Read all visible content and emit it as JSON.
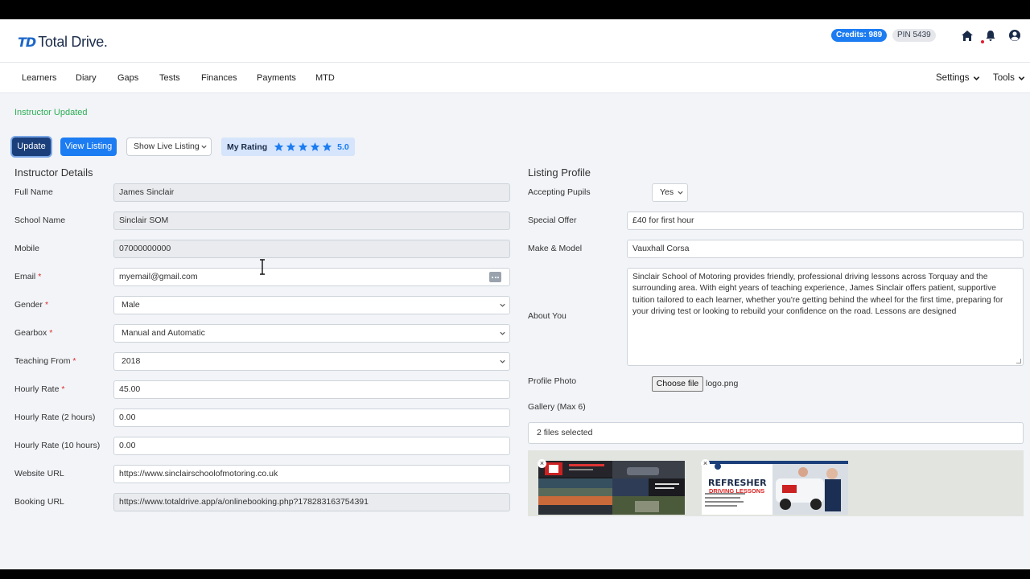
{
  "header": {
    "logo_mark": "TD",
    "logo_text": "Total Drive.",
    "credits": "Credits: 989",
    "pin": "PIN 5439",
    "icons": [
      "home-icon",
      "bell-icon",
      "user-icon"
    ]
  },
  "nav": {
    "items": [
      "Learners",
      "Diary",
      "Gaps",
      "Tests",
      "Finances",
      "Payments",
      "MTD"
    ],
    "right": [
      "Settings",
      "Tools"
    ]
  },
  "status_message": "Instructor Updated",
  "toolbar": {
    "update_label": "Update",
    "view_listing_label": "View Listing",
    "live_listing_select": "Show Live Listing",
    "rating_label": "My Rating",
    "rating_value": "5.0",
    "rating_stars": 5
  },
  "instructor": {
    "title": "Instructor Details",
    "full_name_label": "Full Name",
    "full_name": "James Sinclair",
    "school_name_label": "School Name",
    "school_name": "Sinclair SOM",
    "mobile_label": "Mobile",
    "mobile": "07000000000",
    "email_label": "Email",
    "email": "myemail@gmail.com",
    "gender_label": "Gender",
    "gender": "Male",
    "gearbox_label": "Gearbox",
    "gearbox": "Manual and Automatic",
    "teaching_from_label": "Teaching From",
    "teaching_from": "2018",
    "hourly_rate_label": "Hourly Rate",
    "hourly_rate": "45.00",
    "hourly_rate_2_label": "Hourly Rate (2 hours)",
    "hourly_rate_2": "0.00",
    "hourly_rate_10_label": "Hourly Rate (10 hours)",
    "hourly_rate_10": "0.00",
    "website_label": "Website URL",
    "website": "https://www.sinclairschoolofmotoring.co.uk",
    "booking_label": "Booking URL",
    "booking": "https://www.totaldrive.app/a/onlinebooking.php?178283163754391",
    "required_mark": "*"
  },
  "listing": {
    "title": "Listing Profile",
    "accepting_label": "Accepting Pupils",
    "accepting": "Yes",
    "offer_label": "Special Offer",
    "offer": "£40 for first hour",
    "make_label": "Make & Model",
    "make": "Vauxhall Corsa",
    "about_label": "About You",
    "about": "Sinclair School of Motoring provides friendly, professional driving lessons across Torquay and the surrounding area. With eight years of teaching experience, James Sinclair offers patient, supportive tuition tailored to each learner, whether you're getting behind the wheel for the first time, preparing for your driving test or looking to rebuild your confidence on the road. Lessons are designed",
    "photo_label": "Profile Photo",
    "choose_file": "Choose file",
    "photo_file": "logo.png",
    "gallery_label": "Gallery (Max 6)",
    "gallery_selected": "2 files selected",
    "thumb2_title": "REFRESHER",
    "thumb2_sub": "DRIVING LESSONS",
    "close_glyph": "×"
  },
  "colors": {
    "primary": "#1c7cf2",
    "dark_primary": "#1b3f7a",
    "success": "#2eae55",
    "required": "#d92b2b"
  }
}
